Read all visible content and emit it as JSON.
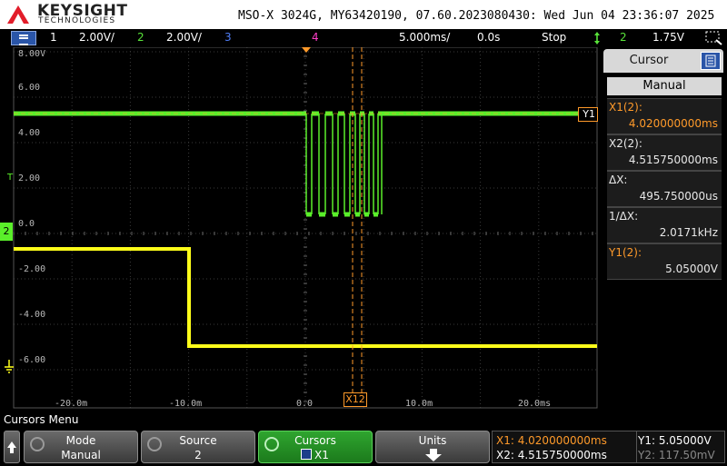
{
  "header": {
    "brand": "KEYSIGHT",
    "brand_sub": "TECHNOLOGIES",
    "device_line": "MSO-X 3024G, MY63420190, 07.60.2023080430: Wed Jun 04 23:36:07 2025"
  },
  "channel_bar": {
    "ch1_num": "1",
    "ch1_scale": "2.00V/",
    "ch2_num": "2",
    "ch2_scale": "2.00V/",
    "ch3_num": "3",
    "ch4_num": "4",
    "timebase": "5.000ms/",
    "delay": "0.0s",
    "run_state": "Stop",
    "trigger_source": "2",
    "trigger_level": "1.75V"
  },
  "waveform": {
    "y_labels": [
      "8.00V",
      "6.00",
      "4.00",
      "2.00",
      "0.0",
      "-2.00",
      "-4.00",
      "-6.00"
    ],
    "x_labels": [
      "-20.0m",
      "-10.0m",
      "0.0",
      "10.0m",
      "20.0ms"
    ],
    "marker_x12": "X12",
    "marker_y1": "Y1",
    "marker_ch2": "2",
    "marker_t": "T",
    "colors": {
      "ch1": "#ffff1a",
      "ch2": "#5aef2a",
      "cursor": "#ff9a2a",
      "grid": "#3a3a3a"
    }
  },
  "side_panel": {
    "title": "Cursor",
    "mode": "Manual",
    "x1_label": "X1(2):",
    "x1_value": "4.020000000ms",
    "x2_label": "X2(2):",
    "x2_value": "4.515750000ms",
    "dx_label": "ΔX:",
    "dx_value": "495.750000us",
    "inv_dx_label": "1/ΔX:",
    "inv_dx_value": "2.0171kHz",
    "y1_label": "Y1(2):",
    "y1_value": "5.05000V"
  },
  "softkeys": {
    "menu_name": "Cursors Menu",
    "mode_label": "Mode",
    "mode_value": "Manual",
    "source_label": "Source",
    "source_value": "2",
    "cursors_label": "Cursors",
    "cursors_value": "X1",
    "units_label": "Units"
  },
  "readout": {
    "x1": "X1: 4.020000000ms",
    "x2": "X2: 4.515750000ms",
    "y1": "Y1: 5.05000V",
    "y2": "Y2: 117.50mV"
  }
}
